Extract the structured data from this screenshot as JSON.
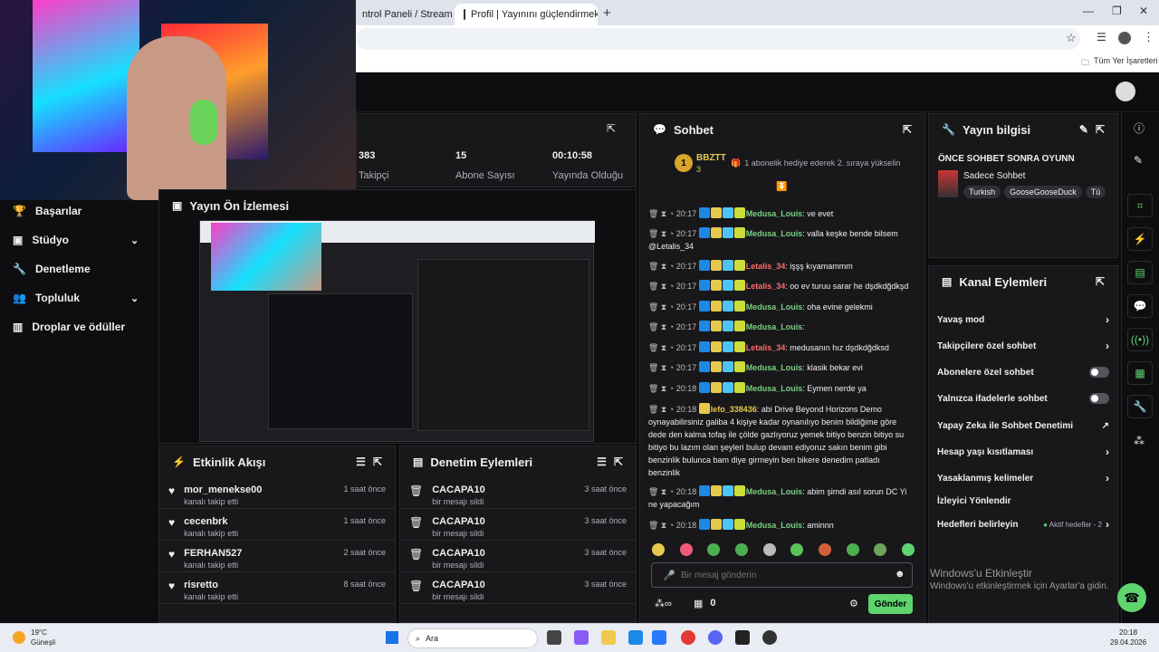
{
  "browser": {
    "tabs": [
      {
        "label": "ntrol Paneli / Streamlabs"
      },
      {
        "label": "Profil | Yayınını güçlendirmek iç"
      }
    ],
    "bookmarks_label": "Tüm Yer İşaretleri"
  },
  "sidebar": {
    "items": [
      {
        "label": "Başarılar"
      },
      {
        "label": "Stüdyo"
      },
      {
        "label": "Denetleme"
      },
      {
        "label": "Topluluk"
      },
      {
        "label": "Droplar ve ödüller"
      }
    ]
  },
  "stats": [
    {
      "value": "383",
      "label": "Takipçi"
    },
    {
      "value": "15",
      "label": "Abone Sayısı"
    },
    {
      "value": "00:10:58",
      "label": "Yayında Olduğu"
    }
  ],
  "preview": {
    "title": "Yayın Ön İzlemesi"
  },
  "activity": {
    "title": "Etkinlik Akışı",
    "items": [
      {
        "user": "mor_menekse00",
        "action": "kanalı takip etti",
        "time": "1 saat önce"
      },
      {
        "user": "cecenbrk",
        "action": "kanalı takip etti",
        "time": "1 saat önce"
      },
      {
        "user": "FERHAN527",
        "action": "kanalı takip etti",
        "time": "2 saat önce"
      },
      {
        "user": "risretto",
        "action": "kanalı takip etti",
        "time": "8 saat önce"
      }
    ]
  },
  "moderation": {
    "title": "Denetim Eylemleri",
    "items": [
      {
        "user": "CACAPA10",
        "action": "bir mesajı sildi",
        "time": "3 saat önce"
      },
      {
        "user": "CACAPA10",
        "action": "bir mesajı sildi",
        "time": "3 saat önce"
      },
      {
        "user": "CACAPA10",
        "action": "bir mesajı sildi",
        "time": "3 saat önce"
      },
      {
        "user": "CACAPA10",
        "action": "bir mesajı sildi",
        "time": "3 saat önce"
      }
    ]
  },
  "chat": {
    "title": "Sohbet",
    "leader": {
      "rank": "1",
      "name": "BBZTT",
      "count": "3"
    },
    "gift_text": "1 abonelik hediye ederek 2. sıraya yükselin",
    "messages": [
      {
        "time": "20:17",
        "user": "Medusa_Louis",
        "cls": "g",
        "text": ": ve evet"
      },
      {
        "time": "20:17",
        "user": "Medusa_Louis",
        "cls": "g",
        "text": ": valla keşke bende bilsem @Letalis_34"
      },
      {
        "time": "20:17",
        "user": "Letalis_34",
        "cls": "r",
        "text": ": işşş kıyamammm"
      },
      {
        "time": "20:17",
        "user": "Letalis_34",
        "cls": "r",
        "text": ": oo ev turuu sarar he dşdkdğdkşd"
      },
      {
        "time": "20:17",
        "user": "Medusa_Louis",
        "cls": "g",
        "text": ": oha evine gelekmi"
      },
      {
        "time": "20:17",
        "user": "Medusa_Louis",
        "cls": "g",
        "text": ":"
      },
      {
        "time": "20:17",
        "user": "Letalis_34",
        "cls": "r",
        "text": ": medusanın hız dşdkdğdksd"
      },
      {
        "time": "20:17",
        "user": "Medusa_Louis",
        "cls": "g",
        "text": ": klasik bekar evi"
      },
      {
        "time": "20:18",
        "user": "Medusa_Louis",
        "cls": "g",
        "text": ": Eymen nerde ya"
      },
      {
        "time": "20:18",
        "user": "lefo_338436",
        "cls": "y",
        "text": ": abi Drive Beyond Horizons Demo oynayabilirsiniz galiba 4 kişiye kadar oynanılıyo benim bildiğime göre dede den kalma tofaş ile çölde gazlıyoruz yemek bitiyo benzin bitiyo su bitiyo bu lazım olan şeyleri bulup devam ediyoruz sakın benim gibi benzinlik bulunca bam diye girmeyin ben bikere denedim patladı benzinlik"
      },
      {
        "time": "20:18",
        "user": "Medusa_Louis",
        "cls": "g",
        "text": ": abim şimdi asıl sorun DC Yi ne yapacağım"
      },
      {
        "time": "20:18",
        "user": "Medusa_Louis",
        "cls": "g",
        "text": ": aminnn"
      }
    ],
    "input_placeholder": "Bir mesaj gönderin",
    "points": "0",
    "send_label": "Gönder"
  },
  "stream_info": {
    "title": "Yayın bilgisi",
    "stream_title": "ÖNCE SOHBET SONRA OYUNN",
    "category": "Sadece Sohbet",
    "tags": [
      "Turkish",
      "GooseGooseDuck",
      "Tü"
    ]
  },
  "channel_actions": {
    "title": "Kanal Eylemleri",
    "items": [
      {
        "label": "Yavaş mod",
        "ctrl": "chev"
      },
      {
        "label": "Takipçilere özel sohbet",
        "ctrl": "chev"
      },
      {
        "label": "Abonelere özel sohbet",
        "ctrl": "toggle"
      },
      {
        "label": "Yalnızca ifadelerle sohbet",
        "ctrl": "toggle"
      },
      {
        "label": "Yapay Zeka ile Sohbet Denetimi",
        "ctrl": "ext"
      },
      {
        "label": "Hesap yaşı kısıtlaması",
        "ctrl": "chev"
      },
      {
        "label": "Yasaklanmış kelimeler",
        "ctrl": "chev"
      },
      {
        "label": "İzleyici Yönlendir",
        "ctrl": "none"
      },
      {
        "label": "Hedefleri belirleyin",
        "ctrl": "chev"
      }
    ],
    "goals_note": "Aktif hedefler - 2"
  },
  "watermark": {
    "line1": "Windows'u Etkinleştir",
    "line2": "Windows'u etkinleştirmek için Ayarlar'a gidin."
  },
  "taskbar": {
    "weather_temp": "19°C",
    "weather_desc": "Güneşli",
    "search": "Ara",
    "time": "20:18",
    "date": "29.04.2026"
  },
  "colors": {
    "accent": "#5ed46f",
    "twitch_bg": "#0e0e10",
    "panel": "#18181b"
  }
}
